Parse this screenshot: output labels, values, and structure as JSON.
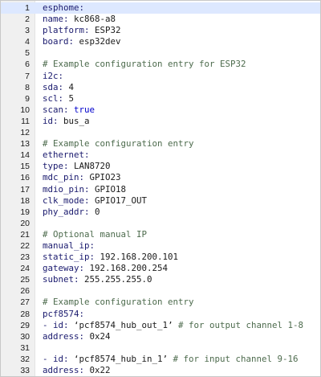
{
  "editor": {
    "error_marker_line": 1,
    "colors": {
      "gutter_bg": "#f0f0f0",
      "active_line": "#dde8ff",
      "key": "#1a1a6e",
      "bool": "#0000cc",
      "comment": "#4d6b4d",
      "error": "#d62020"
    },
    "lines": [
      {
        "n": "1",
        "tokens": [
          {
            "t": "esphome:",
            "c": "key"
          }
        ]
      },
      {
        "n": "2",
        "tokens": [
          {
            "t": "name: ",
            "c": "key"
          },
          {
            "t": "kc868-a8",
            "c": "val"
          }
        ]
      },
      {
        "n": "3",
        "tokens": [
          {
            "t": "platform: ",
            "c": "key"
          },
          {
            "t": "ESP32",
            "c": "val"
          }
        ]
      },
      {
        "n": "4",
        "tokens": [
          {
            "t": "board: ",
            "c": "key"
          },
          {
            "t": "esp32dev",
            "c": "val"
          }
        ]
      },
      {
        "n": "5",
        "tokens": []
      },
      {
        "n": "6",
        "tokens": [
          {
            "t": "# Example configuration entry for ESP32",
            "c": "comment"
          }
        ]
      },
      {
        "n": "7",
        "tokens": [
          {
            "t": "i2c:",
            "c": "key"
          }
        ]
      },
      {
        "n": "8",
        "tokens": [
          {
            "t": "sda: ",
            "c": "key"
          },
          {
            "t": "4",
            "c": "num"
          }
        ]
      },
      {
        "n": "9",
        "tokens": [
          {
            "t": "scl: ",
            "c": "key"
          },
          {
            "t": "5",
            "c": "num"
          }
        ]
      },
      {
        "n": "10",
        "tokens": [
          {
            "t": "scan: ",
            "c": "key"
          },
          {
            "t": "true",
            "c": "bool"
          }
        ]
      },
      {
        "n": "11",
        "tokens": [
          {
            "t": "id: ",
            "c": "key"
          },
          {
            "t": "bus_a",
            "c": "val"
          }
        ]
      },
      {
        "n": "12",
        "tokens": []
      },
      {
        "n": "13",
        "tokens": [
          {
            "t": "# Example configuration entry",
            "c": "comment"
          }
        ]
      },
      {
        "n": "14",
        "tokens": [
          {
            "t": "ethernet:",
            "c": "key"
          }
        ]
      },
      {
        "n": "15",
        "tokens": [
          {
            "t": "type: ",
            "c": "key"
          },
          {
            "t": "LAN8720",
            "c": "val"
          }
        ]
      },
      {
        "n": "16",
        "tokens": [
          {
            "t": "mdc_pin: ",
            "c": "key"
          },
          {
            "t": "GPIO23",
            "c": "val"
          }
        ]
      },
      {
        "n": "17",
        "tokens": [
          {
            "t": "mdio_pin: ",
            "c": "key"
          },
          {
            "t": "GPIO18",
            "c": "val"
          }
        ]
      },
      {
        "n": "18",
        "tokens": [
          {
            "t": "clk_mode: ",
            "c": "key"
          },
          {
            "t": "GPIO17_OUT",
            "c": "val"
          }
        ]
      },
      {
        "n": "19",
        "tokens": [
          {
            "t": "phy_addr: ",
            "c": "key"
          },
          {
            "t": "0",
            "c": "num"
          }
        ]
      },
      {
        "n": "20",
        "tokens": []
      },
      {
        "n": "21",
        "tokens": [
          {
            "t": "# Optional manual IP",
            "c": "comment"
          }
        ]
      },
      {
        "n": "22",
        "tokens": [
          {
            "t": "manual_ip:",
            "c": "key"
          }
        ]
      },
      {
        "n": "23",
        "tokens": [
          {
            "t": "static_ip: ",
            "c": "key"
          },
          {
            "t": "192.168.200.101",
            "c": "num"
          }
        ]
      },
      {
        "n": "24",
        "tokens": [
          {
            "t": "gateway: ",
            "c": "key"
          },
          {
            "t": "192.168.200.254",
            "c": "num"
          }
        ]
      },
      {
        "n": "25",
        "tokens": [
          {
            "t": "subnet: ",
            "c": "key"
          },
          {
            "t": "255.255.255.0",
            "c": "num"
          }
        ]
      },
      {
        "n": "26",
        "tokens": []
      },
      {
        "n": "27",
        "tokens": [
          {
            "t": "# Example configuration entry",
            "c": "comment"
          }
        ]
      },
      {
        "n": "28",
        "tokens": [
          {
            "t": "pcf8574:",
            "c": "key"
          }
        ]
      },
      {
        "n": "29",
        "tokens": [
          {
            "t": "- id: ",
            "c": "key"
          },
          {
            "t": "‘pcf8574_hub_out_1’ ",
            "c": "val"
          },
          {
            "t": "# for output channel 1-8",
            "c": "comment"
          }
        ]
      },
      {
        "n": "30",
        "tokens": [
          {
            "t": "address: ",
            "c": "key"
          },
          {
            "t": "0x24",
            "c": "num"
          }
        ]
      },
      {
        "n": "31",
        "tokens": []
      },
      {
        "n": "32",
        "tokens": [
          {
            "t": "- id: ",
            "c": "key"
          },
          {
            "t": "‘pcf8574_hub_in_1’ ",
            "c": "val"
          },
          {
            "t": "# for input channel 9-16",
            "c": "comment"
          }
        ]
      },
      {
        "n": "33",
        "tokens": [
          {
            "t": "address: ",
            "c": "key"
          },
          {
            "t": "0x22",
            "c": "num"
          }
        ]
      }
    ]
  }
}
